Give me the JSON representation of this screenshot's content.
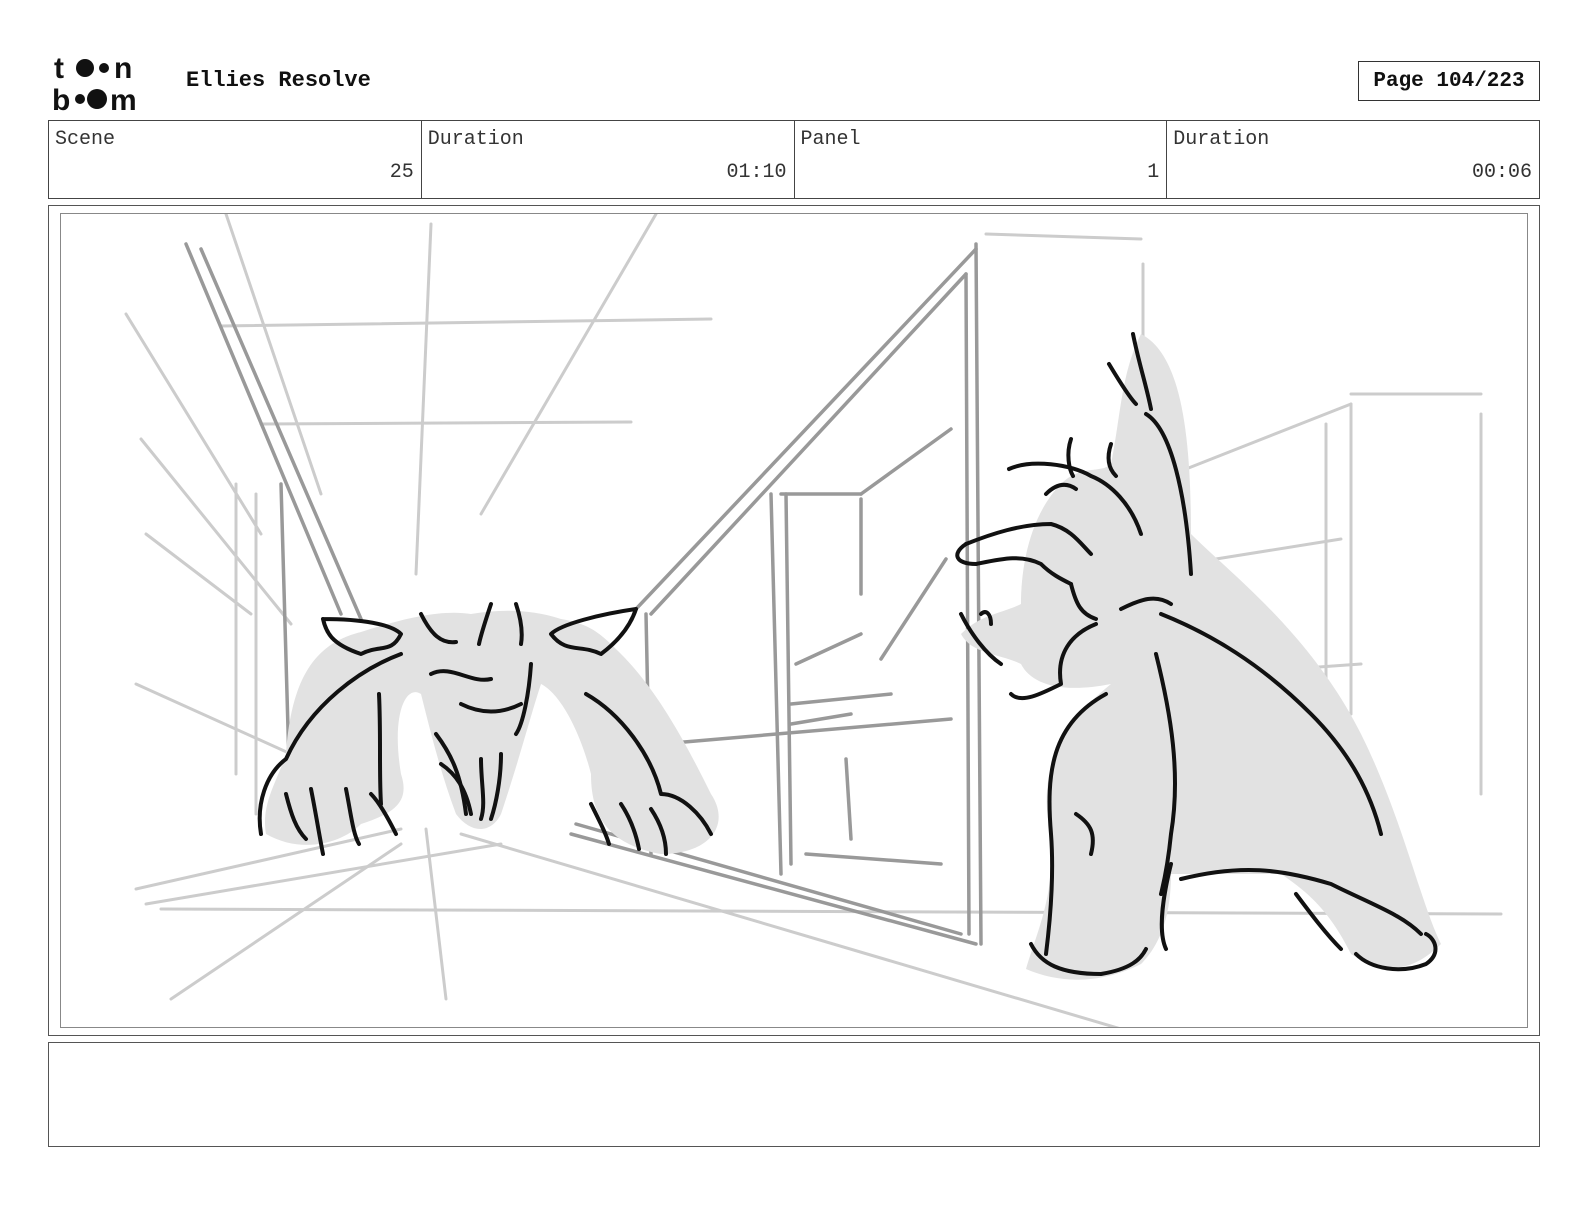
{
  "header": {
    "logo_text": "toon boom",
    "title": "Ellies Resolve",
    "page": "Page 104/223"
  },
  "info": {
    "scene_label": "Scene",
    "scene_value": "25",
    "scene_duration_label": "Duration",
    "scene_duration_value": "01:10",
    "panel_label": "Panel",
    "panel_value": "1",
    "panel_duration_label": "Duration",
    "panel_duration_value": "00:06"
  },
  "panel": {
    "image_icon": "storyboard-sketch"
  },
  "notes": {
    "text": ""
  }
}
